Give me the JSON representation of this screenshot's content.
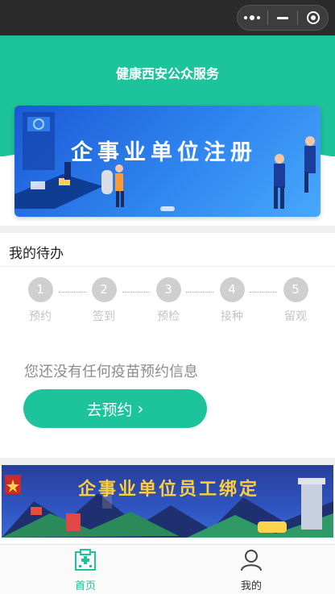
{
  "header": {
    "title": "健康西安公众服务"
  },
  "banner": {
    "text": "企事业单位注册"
  },
  "todo": {
    "title": "我的待办",
    "steps": [
      {
        "num": "1",
        "label": "预约"
      },
      {
        "num": "2",
        "label": "签到"
      },
      {
        "num": "3",
        "label": "预检"
      },
      {
        "num": "4",
        "label": "接种"
      },
      {
        "num": "5",
        "label": "留观"
      }
    ],
    "empty_message": "您还没有任何疫苗预约信息",
    "book_button": "去预约"
  },
  "banner2": {
    "text": "企事业单位员工绑定"
  },
  "tabbar": {
    "home": "首页",
    "mine": "我的"
  },
  "colors": {
    "accent": "#1dc39a",
    "topbar": "#2b2b2b"
  },
  "icons": {
    "home": "hospital-icon",
    "mine": "user-icon"
  }
}
